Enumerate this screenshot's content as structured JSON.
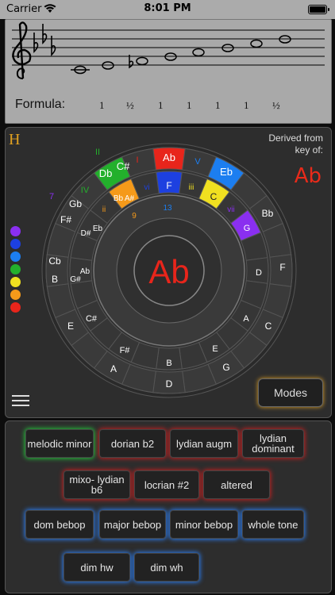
{
  "status_bar": {
    "carrier": "Carrier",
    "time": "8:01 PM"
  },
  "staff": {
    "formula_label": "Formula:",
    "intervals": [
      "1",
      "½",
      "1",
      "1",
      "1",
      "1",
      "½"
    ]
  },
  "wheel": {
    "derived_label_1": "Derived from",
    "derived_label_2": "key of:",
    "derived_key": "Ab",
    "center_key": "Ab",
    "h_label": "H",
    "outer_ring": {
      "colored": [
        {
          "note": "Ab",
          "color": "#e8251b"
        },
        {
          "note": "Eb",
          "color": "#1c7ef0"
        },
        {
          "note": "Db",
          "color": "#23b02c"
        }
      ],
      "notes": [
        "C#",
        "Gb",
        "F#",
        "Cb",
        "B",
        "E",
        "A",
        "D",
        "G",
        "C",
        "F",
        "Bb"
      ],
      "degrees": [
        "I",
        "V",
        "IV",
        "II",
        "7"
      ]
    },
    "middle_ring": {
      "colored": [
        {
          "note": "F",
          "color": "#1d40e0"
        },
        {
          "note": "C",
          "color": "#f0e020"
        },
        {
          "note": "G",
          "color": "#8a2ff0"
        },
        {
          "note": "Bb",
          "color": "#f59a1a"
        },
        {
          "note": "A#",
          "color": "#f59a1a"
        }
      ],
      "notes": [
        "D#",
        "Eb",
        "G#",
        "Ab",
        "C#",
        "F#",
        "B",
        "E",
        "A",
        "D"
      ],
      "degrees": [
        "vi",
        "iii",
        "vii",
        "ii",
        "9",
        "13"
      ]
    },
    "color_dots": [
      "#8a2ff0",
      "#1d40e0",
      "#1c7ef0",
      "#23b02c",
      "#f0e020",
      "#f59a1a",
      "#e8251b"
    ],
    "modes_button": "Modes"
  },
  "modes": {
    "row1": [
      "melodic minor",
      "dorian b2",
      "lydian augm",
      "lydian dominant"
    ],
    "row2": [
      "mixo- lydian b6",
      "locrian #2",
      "altered"
    ],
    "row3": [
      "dom bebop",
      "major bebop",
      "minor bebop",
      "whole tone"
    ],
    "row4": [
      "dim hw",
      "dim wh"
    ]
  }
}
